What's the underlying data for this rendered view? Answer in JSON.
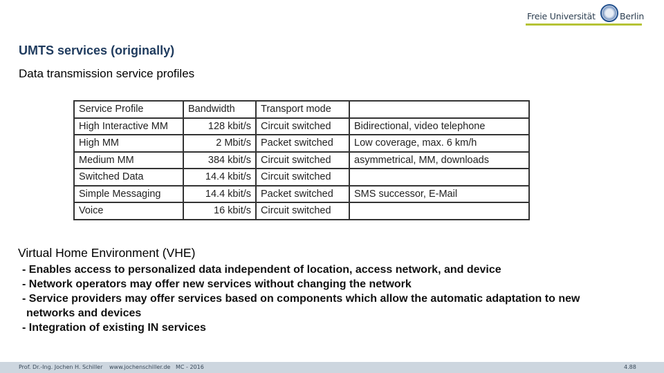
{
  "header": {
    "logo": {
      "left_text": "Freie Universität",
      "right_text": "Berlin"
    }
  },
  "slide": {
    "title": "UMTS services (originally)",
    "subtitle": "Data transmission service profiles"
  },
  "table": {
    "headers": [
      "Service Profile",
      "Bandwidth",
      "Transport mode",
      ""
    ],
    "rows": [
      [
        "High Interactive MM",
        "128 kbit/s",
        "Circuit switched",
        "Bidirectional, video telephone"
      ],
      [
        "High MM",
        "2 Mbit/s",
        "Packet switched",
        "Low coverage, max. 6 km/h"
      ],
      [
        "Medium MM",
        "384 kbit/s",
        "Circuit switched",
        "asymmetrical, MM, downloads"
      ],
      [
        "Switched Data",
        "14.4 kbit/s",
        "Circuit switched",
        ""
      ],
      [
        "Simple Messaging",
        "14.4 kbit/s",
        "Packet switched",
        "SMS successor, E-Mail"
      ],
      [
        "Voice",
        "16 kbit/s",
        "Circuit switched",
        ""
      ]
    ]
  },
  "vhe": {
    "heading": "Virtual Home Environment (VHE)",
    "bullets": [
      "- Enables access to personalized data independent of location, access network, and device",
      "- Network operators may offer new services without changing the network",
      "- Service providers may offer services based on components which allow the automatic adaptation to new",
      "networks and devices",
      "- Integration of existing IN services"
    ]
  },
  "footer": {
    "author": "Prof. Dr.-Ing. Jochen H. Schiller",
    "website": "www.jochenschiller.de",
    "course": "MC - 2016",
    "page": "4.88"
  }
}
